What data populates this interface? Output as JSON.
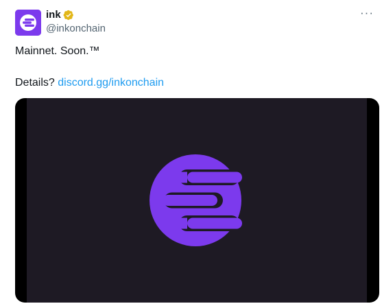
{
  "author": {
    "display_name": "ink",
    "handle": "@inkonchain",
    "verified": true,
    "avatar_icon": "ink-logo-icon"
  },
  "menu": {
    "more_label": "···"
  },
  "tweet": {
    "line1": "Mainnet. Soon.™",
    "line2_prefix": "Details? ",
    "link_text": "discord.gg/inkonchain"
  },
  "media": {
    "logo_icon": "ink-logo-icon"
  },
  "colors": {
    "brand": "#7c3aed",
    "link": "#1d9bf0",
    "media_bg": "#1e1a24",
    "verified_badge": "#e2b719"
  }
}
